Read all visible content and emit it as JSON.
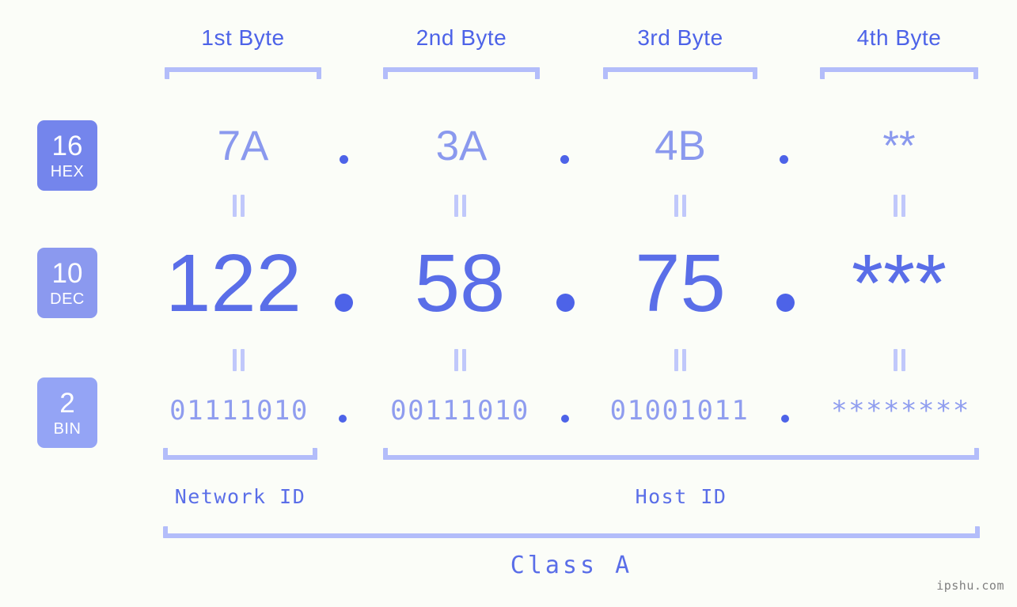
{
  "watermark": "ipshu.com",
  "byte_headers": [
    {
      "label": "1st Byte"
    },
    {
      "label": "2nd Byte"
    },
    {
      "label": "3rd Byte"
    },
    {
      "label": "4th Byte"
    }
  ],
  "bases": [
    {
      "number": "16",
      "name": "HEX",
      "color": "#7485ec"
    },
    {
      "number": "10",
      "name": "DEC",
      "color": "#8b99ef"
    },
    {
      "number": "2",
      "name": "BIN",
      "color": "#94a4f5"
    }
  ],
  "rows": {
    "hex": {
      "values": [
        "7A",
        "3A",
        "4B",
        "**"
      ],
      "separator": "."
    },
    "dec": {
      "values": [
        "122",
        "58",
        "75",
        "***"
      ],
      "separator": "."
    },
    "bin": {
      "values": [
        "01111010",
        "00111010",
        "01001011",
        "********"
      ],
      "separator": "."
    }
  },
  "equals_marker": "=",
  "segments": {
    "network_id": "Network ID",
    "host_id": "Host ID"
  },
  "class_label": "Class A",
  "colors": {
    "background": "#fbfdf8",
    "accent_dark": "#4d63e8",
    "accent_mid": "#5a6ee8",
    "accent_light": "#8a99ee",
    "bracket": "#b3bdfa",
    "equals": "#c0c8fb"
  },
  "chart_data": {
    "type": "table",
    "title": "IP address 122.58.75.* byte decomposition",
    "columns": [
      "1st Byte",
      "2nd Byte",
      "3rd Byte",
      "4th Byte"
    ],
    "rows": [
      {
        "base": "16 HEX",
        "values": [
          "7A",
          "3A",
          "4B",
          "**"
        ]
      },
      {
        "base": "10 DEC",
        "values": [
          "122",
          "58",
          "75",
          "***"
        ]
      },
      {
        "base": "2 BIN",
        "values": [
          "01111010",
          "00111010",
          "01001011",
          "********"
        ]
      }
    ],
    "annotations": {
      "network_id_bytes": [
        "1st Byte"
      ],
      "host_id_bytes": [
        "2nd Byte",
        "3rd Byte",
        "4th Byte"
      ],
      "class": "Class A"
    }
  }
}
